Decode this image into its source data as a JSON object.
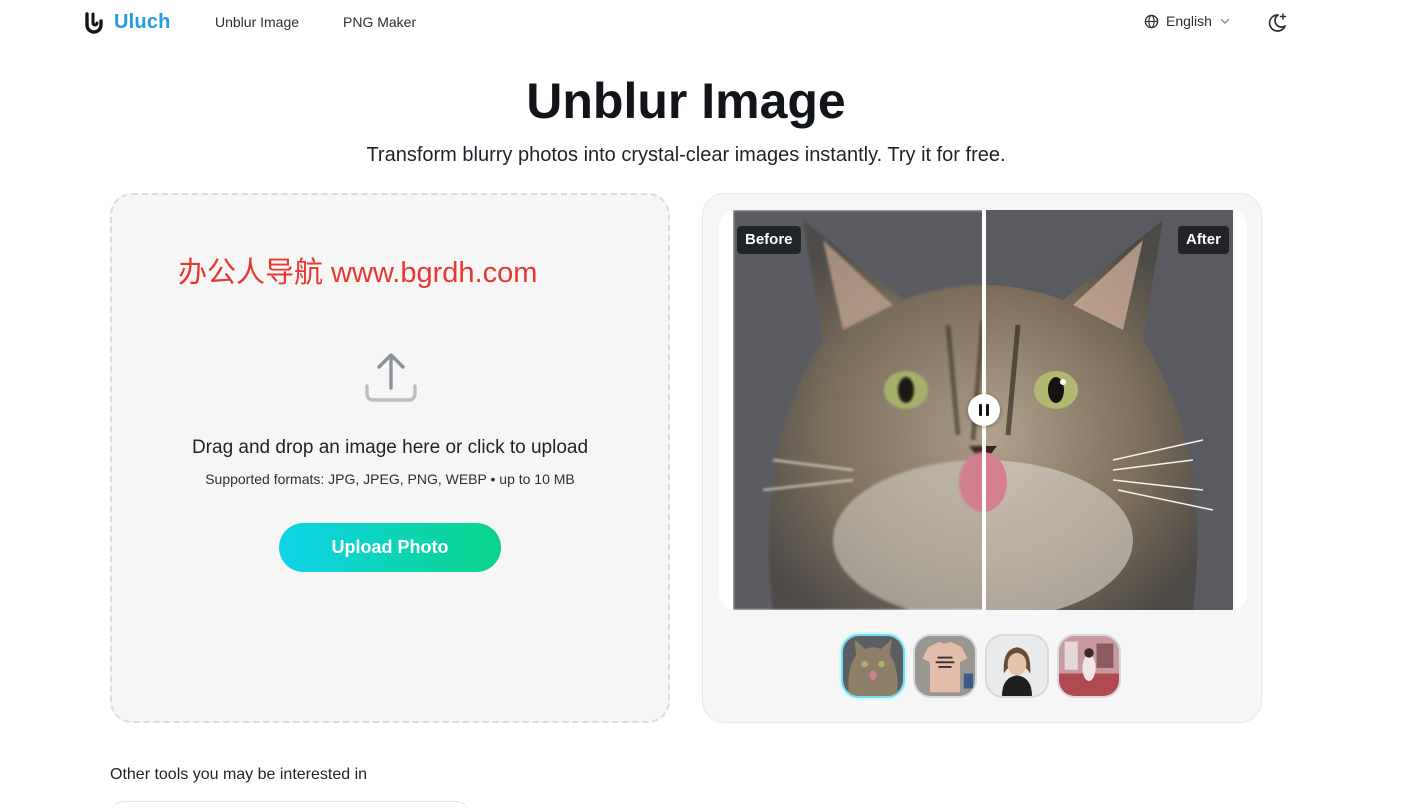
{
  "header": {
    "logo_text": "Uluch",
    "nav": [
      "Unblur Image",
      "PNG Maker"
    ],
    "language": "English"
  },
  "hero": {
    "title": "Unblur Image",
    "subtitle": "Transform blurry photos into crystal-clear images instantly. Try it for free."
  },
  "upload": {
    "watermark": "办公人导航  www.bgrdh.com",
    "drop_text": "Drag and drop an image here or click to upload",
    "formats": "Supported formats: JPG, JPEG, PNG, WEBP • up to 10 MB",
    "button": "Upload Photo"
  },
  "compare": {
    "before_label": "Before",
    "after_label": "After",
    "thumbnails": [
      "cat",
      "t-shirt",
      "portrait",
      "street-scene"
    ],
    "active_thumbnail": "cat"
  },
  "other_tools": {
    "heading": "Other tools you may be interested in"
  },
  "colors": {
    "brand": "#1f9be8",
    "button_start": "#0fd3e8",
    "button_end": "#0ad48a",
    "watermark": "#e8382f"
  },
  "icons": [
    "logo-icon",
    "globe-icon",
    "chevron-down-icon",
    "moon-icon",
    "upload-icon",
    "pause-icon"
  ]
}
